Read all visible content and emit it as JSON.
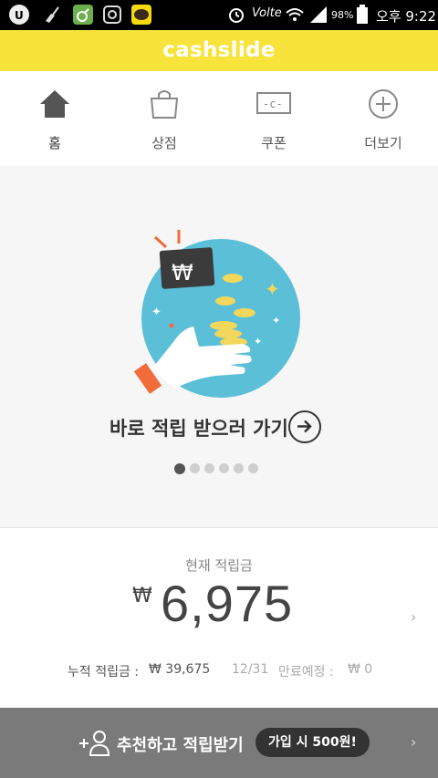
{
  "status_bar": {
    "battery": "98%",
    "network": "Volte",
    "time": "오후 9:22"
  },
  "header": {
    "logo": "cashslide"
  },
  "tabs": [
    {
      "label": "홈",
      "icon": "home-icon"
    },
    {
      "label": "상점",
      "icon": "shopping-bag-icon"
    },
    {
      "label": "쿠폰",
      "icon": "coupon-icon"
    },
    {
      "label": "더보기",
      "icon": "plus-circle-icon"
    }
  ],
  "banner": {
    "wallet_symbol": "₩",
    "cta_text": "바로 적립 받으러 가기",
    "slide_count": 6,
    "active_slide": 1
  },
  "balance": {
    "label": "현재 적립금",
    "currency": "₩",
    "amount": "6,975",
    "cumulative_label": "누적 적립금 :",
    "cumulative_value": "₩ 39,675",
    "expiry_date": "12/31",
    "expiry_label": "만료예정 :",
    "expiry_value": "₩ 0"
  },
  "referral": {
    "text": "추천하고 적립받기",
    "badge": "가입 시 500원!"
  },
  "colors": {
    "brand_yellow": "#f7e33a",
    "illustration_blue": "#5bbfd8",
    "coin_yellow": "#f2d75b"
  }
}
